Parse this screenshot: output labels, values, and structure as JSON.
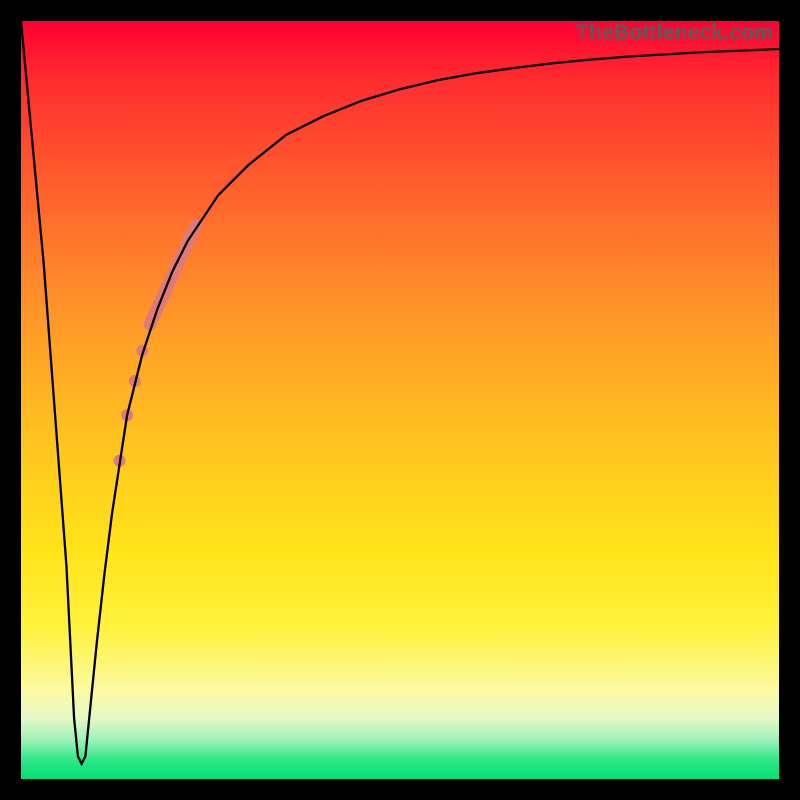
{
  "watermark": "TheBottleneck.com",
  "gradient": {
    "top": "#ff0030",
    "mid1": "#ff9a28",
    "mid2": "#ffe41a",
    "band": "#fcfa9e",
    "bottom": "#00e077"
  },
  "chart_data": {
    "type": "line",
    "title": "",
    "xlabel": "",
    "ylabel": "",
    "xlim": [
      0,
      100
    ],
    "ylim": [
      0,
      100
    ],
    "grid": false,
    "series": [
      {
        "name": "bottleneck-curve",
        "color": "#000000",
        "x": [
          0,
          3,
          6,
          7,
          7.5,
          8,
          8.5,
          9,
          10,
          11,
          12,
          14,
          16,
          18,
          20,
          22,
          24,
          26,
          30,
          35,
          40,
          45,
          50,
          55,
          60,
          65,
          70,
          75,
          80,
          85,
          90,
          95,
          100
        ],
        "values": [
          100,
          68,
          28,
          8,
          3,
          2,
          3,
          8,
          18,
          27,
          35,
          48,
          56,
          62,
          67,
          71,
          74,
          77,
          81,
          85,
          87.5,
          89.5,
          91,
          92.2,
          93.1,
          93.8,
          94.4,
          94.9,
          95.3,
          95.6,
          95.9,
          96.1,
          96.3
        ]
      }
    ],
    "overlay": {
      "name": "highlight-band",
      "color": "#e07a7a",
      "segments": [
        {
          "start": {
            "x": 17,
            "y": 60
          },
          "end": {
            "x": 23,
            "y": 73
          },
          "width": 12.5
        }
      ],
      "dots": [
        {
          "x": 16.0,
          "y": 56.5,
          "r": 6.0
        },
        {
          "x": 15.0,
          "y": 52.5,
          "r": 6.0
        },
        {
          "x": 14.0,
          "y": 48.0,
          "r": 6.0
        },
        {
          "x": 13.0,
          "y": 42.0,
          "r": 6.0
        }
      ]
    }
  }
}
